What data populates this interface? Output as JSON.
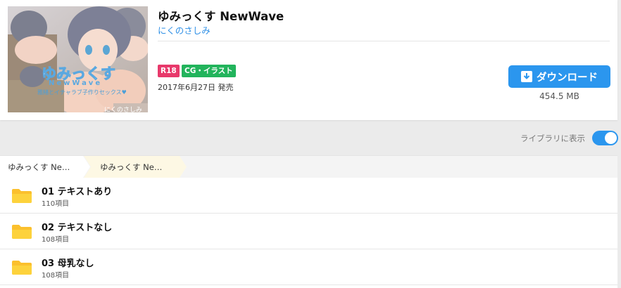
{
  "work": {
    "title": "ゆみっくす NewWave",
    "author": "にくのさしみ",
    "badges": [
      "R18",
      "CG・イラスト"
    ],
    "release_date": "2017年6月27日 発売",
    "download_label": "ダウンロード",
    "file_size": "454.5 MB",
    "cover_text": {
      "logo": "ゆみっくす",
      "logo_sub": "NewWave",
      "tagline": "雅緒とイチャラブ子作りセックス♥",
      "circle": "にくのさしみ"
    }
  },
  "library": {
    "show_label": "ライブラリに表示",
    "show_enabled": true
  },
  "breadcrumb": [
    "ゆみっくす Ne…",
    "ゆみっくす Ne…"
  ],
  "folders": [
    {
      "name": "01 テキストあり",
      "count": "110項目"
    },
    {
      "name": "02 テキストなし",
      "count": "108項目"
    },
    {
      "name": "03 母乳なし",
      "count": "108項目"
    }
  ],
  "colors": {
    "accent": "#2b96ee",
    "r18_badge": "#e8396b",
    "cg_badge": "#22b45c",
    "folder": "#fbc02d"
  }
}
